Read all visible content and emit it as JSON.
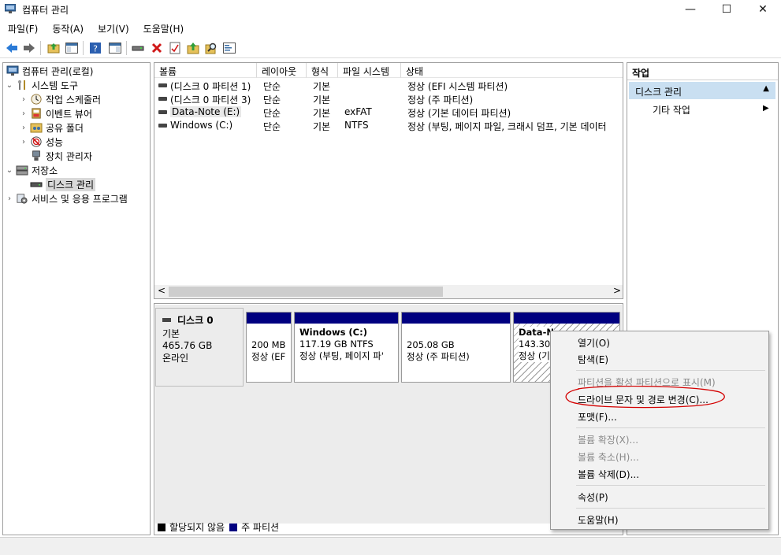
{
  "window": {
    "title": "컴퓨터 관리",
    "minimize_glyph": "—",
    "maximize_glyph": "☐",
    "close_glyph": "✕"
  },
  "menu": [
    "파일(F)",
    "동작(A)",
    "보기(V)",
    "도움말(H)"
  ],
  "toolbar_icons": [
    "back-arrow-icon",
    "forward-arrow-icon",
    "up-folder-icon",
    "console-tree-icon",
    "help-icon",
    "properties-pane-icon",
    "connect-drive-icon",
    "delete-icon",
    "properties-icon",
    "folder-up-icon",
    "search-icon",
    "rescan-icon"
  ],
  "tree": {
    "root": "컴퓨터 관리(로컬)",
    "system_tools": "시스템 도구",
    "task_scheduler": "작업 스케줄러",
    "event_viewer": "이벤트 뷰어",
    "shared_folders": "공유 폴더",
    "performance": "성능",
    "device_manager": "장치 관리자",
    "storage": "저장소",
    "disk_management": "디스크 관리",
    "services": "서비스 및 응용 프로그램"
  },
  "volumes": {
    "columns": [
      "볼륨",
      "레이아웃",
      "형식",
      "파일 시스템",
      "상태"
    ],
    "rows": [
      {
        "volume": "(디스크 0 파티션 1)",
        "layout": "단순",
        "type": "기본",
        "fs": "",
        "status": "정상 (EFI 시스템 파티션)"
      },
      {
        "volume": "(디스크 0 파티션 3)",
        "layout": "단순",
        "type": "기본",
        "fs": "",
        "status": "정상 (주 파티션)"
      },
      {
        "volume": "Data-Note (E:)",
        "layout": "단순",
        "type": "기본",
        "fs": "exFAT",
        "status": "정상 (기본 데이터 파티션)"
      },
      {
        "volume": "Windows (C:)",
        "layout": "단순",
        "type": "기본",
        "fs": "NTFS",
        "status": "정상 (부팅, 페이지 파일, 크래시 덤프, 기본 데이터"
      }
    ],
    "scroll_left": "<",
    "scroll_right": ">"
  },
  "disk": {
    "name": "디스크 0",
    "type": "기본",
    "size": "465.76 GB",
    "state": "온라인",
    "partitions": [
      {
        "name": "",
        "size": "200 MB",
        "status": "정상 (EF"
      },
      {
        "name": "Windows  (C:)",
        "size": "117.19 GB NTFS",
        "status": "정상 (부팅, 페이지 파'"
      },
      {
        "name": "",
        "size": "205.08 GB",
        "status": "정상 (주 파티션)"
      },
      {
        "name": "Data-N",
        "size": "143.30",
        "status": "정상 (기"
      }
    ]
  },
  "legend": [
    {
      "label": "할당되지 않음",
      "color": "#000000"
    },
    {
      "label": "주 파티션",
      "color": "#000080"
    }
  ],
  "actions": {
    "header": "작업",
    "section": "디스크 관리",
    "more": "기타 작업"
  },
  "context_menu": {
    "items": [
      {
        "label": "열기(O)",
        "enabled": true
      },
      {
        "label": "탐색(E)",
        "enabled": true
      },
      {
        "label": "파티션을 활성 파티션으로 표시(M)",
        "enabled": false
      },
      {
        "label": "드라이브 문자 및 경로 변경(C)...",
        "enabled": true
      },
      {
        "label": "포맷(F)...",
        "enabled": true
      },
      {
        "label": "볼륨 확장(X)...",
        "enabled": false
      },
      {
        "label": "볼륨 축소(H)...",
        "enabled": false
      },
      {
        "label": "볼륨 삭제(D)...",
        "enabled": true
      },
      {
        "label": "속성(P)",
        "enabled": true
      },
      {
        "label": "도움말(H)",
        "enabled": true
      }
    ]
  },
  "colors": {
    "primary_partition": "#000080",
    "selection": "#c9dff1",
    "annotation": "#d40000"
  }
}
